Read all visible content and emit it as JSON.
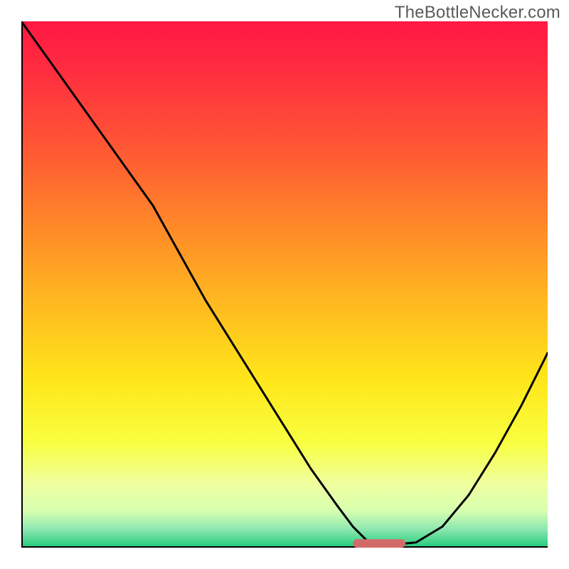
{
  "watermark": "TheBottleNecker.com",
  "chart_data": {
    "type": "line",
    "title": "",
    "xlabel": "",
    "ylabel": "",
    "xlim": [
      0,
      100
    ],
    "ylim": [
      0,
      100
    ],
    "series": [
      {
        "name": "curve",
        "x": [
          0,
          5,
          10,
          15,
          20,
          25,
          30,
          35,
          40,
          45,
          50,
          55,
          60,
          63,
          66,
          70,
          75,
          80,
          85,
          90,
          95,
          100
        ],
        "values": [
          100,
          93,
          86,
          79,
          72,
          65,
          56,
          47,
          39,
          31,
          23,
          15,
          8,
          4,
          1,
          0.5,
          1,
          4,
          10,
          18,
          27,
          37
        ]
      }
    ],
    "marker": {
      "shape": "rounded-rect",
      "color": "#d36a6a",
      "x_center": 68,
      "y_center": 0.8,
      "width": 10,
      "height": 1.6
    },
    "background_gradient_stops": [
      {
        "offset": 0.0,
        "color": "#ff1744"
      },
      {
        "offset": 0.1,
        "color": "#ff2f3f"
      },
      {
        "offset": 0.25,
        "color": "#ff5a33"
      },
      {
        "offset": 0.4,
        "color": "#ff8c28"
      },
      {
        "offset": 0.55,
        "color": "#ffbe1f"
      },
      {
        "offset": 0.68,
        "color": "#ffe61a"
      },
      {
        "offset": 0.8,
        "color": "#f8ff40"
      },
      {
        "offset": 0.88,
        "color": "#efffa0"
      },
      {
        "offset": 0.93,
        "color": "#d7ffb0"
      },
      {
        "offset": 0.965,
        "color": "#8de8b0"
      },
      {
        "offset": 1.0,
        "color": "#20c97a"
      }
    ],
    "axis": {
      "color": "#000000",
      "width": 4
    },
    "line_style": {
      "color": "#000000",
      "width": 3
    }
  }
}
